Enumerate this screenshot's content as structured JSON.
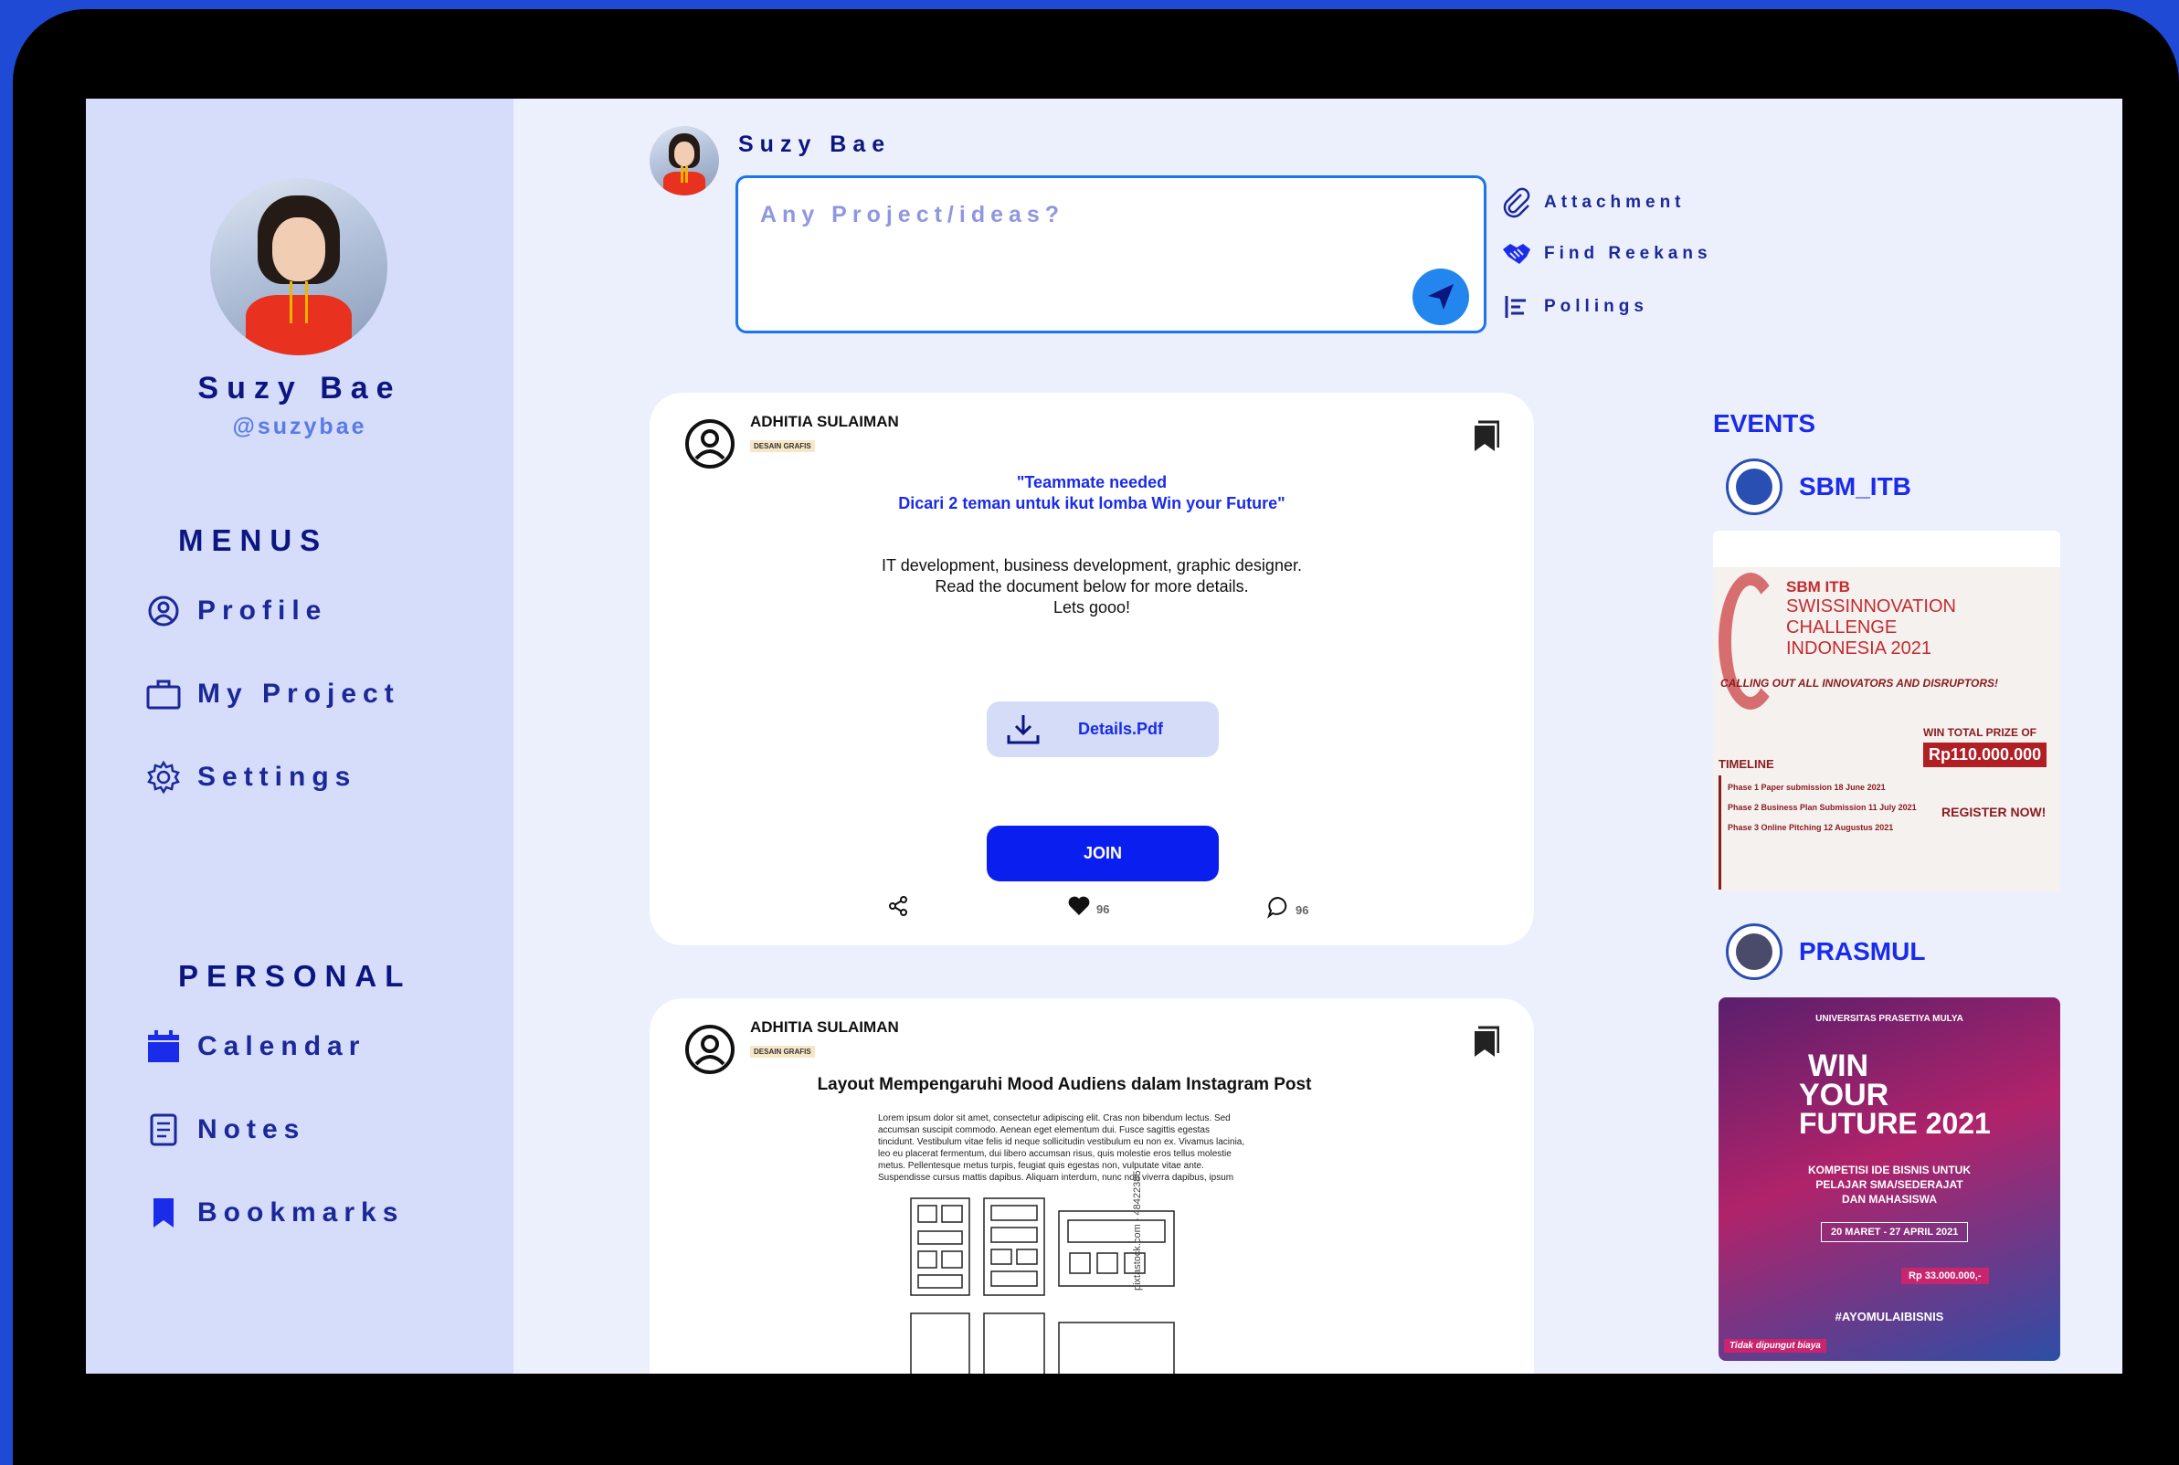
{
  "sidebar": {
    "name": "Suzy Bae",
    "handle": "@suzybae",
    "menus_title": "MENUS",
    "menus": [
      {
        "label": "Profile",
        "icon": "user-circle-icon"
      },
      {
        "label": "My Project",
        "icon": "briefcase-icon"
      },
      {
        "label": "Settings",
        "icon": "gear-icon"
      }
    ],
    "personal_title": "PERSONAL",
    "personal": [
      {
        "label": "Calendar",
        "icon": "calendar-icon"
      },
      {
        "label": "Notes",
        "icon": "notes-icon"
      },
      {
        "label": "Bookmarks",
        "icon": "bookmark-icon"
      }
    ]
  },
  "composer": {
    "name": "Suzy Bae",
    "placeholder": "Any Project/ideas?",
    "actions": [
      {
        "label": "Attachment",
        "icon": "paperclip-icon"
      },
      {
        "label": "Find Reekans",
        "icon": "handshake-icon"
      },
      {
        "label": "Pollings",
        "icon": "poll-icon"
      }
    ]
  },
  "posts": [
    {
      "author": "ADHITIA SULAIMAN",
      "tag": "DESAIN GRAFIS",
      "headline_1": "\"Teammate needed",
      "headline_2": "Dicari 2 teman untuk ikut lomba Win your Future\"",
      "body_1": "IT development, business development, graphic designer.",
      "body_2": "Read the document below for more details.",
      "body_3": "Lets gooo!",
      "attachment": "Details.Pdf",
      "join": "JOIN",
      "likes": "96",
      "comments": "96"
    },
    {
      "author": "ADHITIA SULAIMAN",
      "tag": "DESAIN GRAFIS",
      "title": "Layout Mempengaruhi Mood Audiens dalam Instagram Post",
      "lorem": [
        "Lorem ipsum dolor sit amet, consectetur adipiscing elit. Cras non bibendum lectus. Sed",
        "accumsan suscipit commodo. Aenean eget elementum dui. Fusce sagittis egestas",
        "tincidunt. Vestibulum vitae felis id neque sollicitudin vestibulum eu non ex. Vivamus lacinia,",
        "leo eu placerat fermentum, dui libero accumsan risus, quis molestie eros tellus molestie",
        "metus. Pellentesque metus turpis, feugiat quis egestas non, vulputate vitae ante.",
        "Suspendisse cursus mattis dapibus. Aliquam interdum, nunc non viverra dapibus, ipsum"
      ],
      "watermark": "pixtastock.com - 48422385"
    }
  ],
  "events": {
    "title": "EVENTS",
    "orgs": [
      {
        "name": "SBM_ITB",
        "poster": {
          "title_1": "SBM ITB",
          "title_2": "SWISSINNOVATION",
          "title_3": "CHALLENGE",
          "title_4": "INDONESIA 2021",
          "callout": "CALLING OUT ALL INNOVATORS AND DISRUPTORS!",
          "prize_label": "WIN TOTAL PRIZE OF",
          "prize": "Rp110.000.000",
          "timeline": "TIMELINE",
          "phase_1": "Phase 1 Paper submission 18 June 2021",
          "phase_2": "Phase 2 Business Plan Submission 11 July 2021",
          "phase_3": "Phase 3 Online Pitching 12 Augustus 2021",
          "register": "REGISTER NOW!"
        }
      },
      {
        "name": "PRASMUL",
        "poster": {
          "top": "UNIVERSITAS PRASETIYA MULYA",
          "win": "WIN",
          "your": "YOUR",
          "future": "FUTURE 2021",
          "sub_1": "KOMPETISI IDE BISNIS UNTUK",
          "sub_2": "PELAJAR SMA/SEDERAJAT",
          "sub_3": "DAN MAHASISWA",
          "period": "20 MARET - 27 APRIL 2021",
          "prize": "Rp 33.000.000,-",
          "hashtag": "#AYOMULAIBISNIS",
          "free": "Tidak dipungut biaya"
        }
      }
    ]
  },
  "colors": {
    "accent": "#1a2bea",
    "navy": "#0c1580",
    "sidebar": "#d5ddfb",
    "background": "#ecf0fd",
    "frame": "#1f4ad6"
  }
}
